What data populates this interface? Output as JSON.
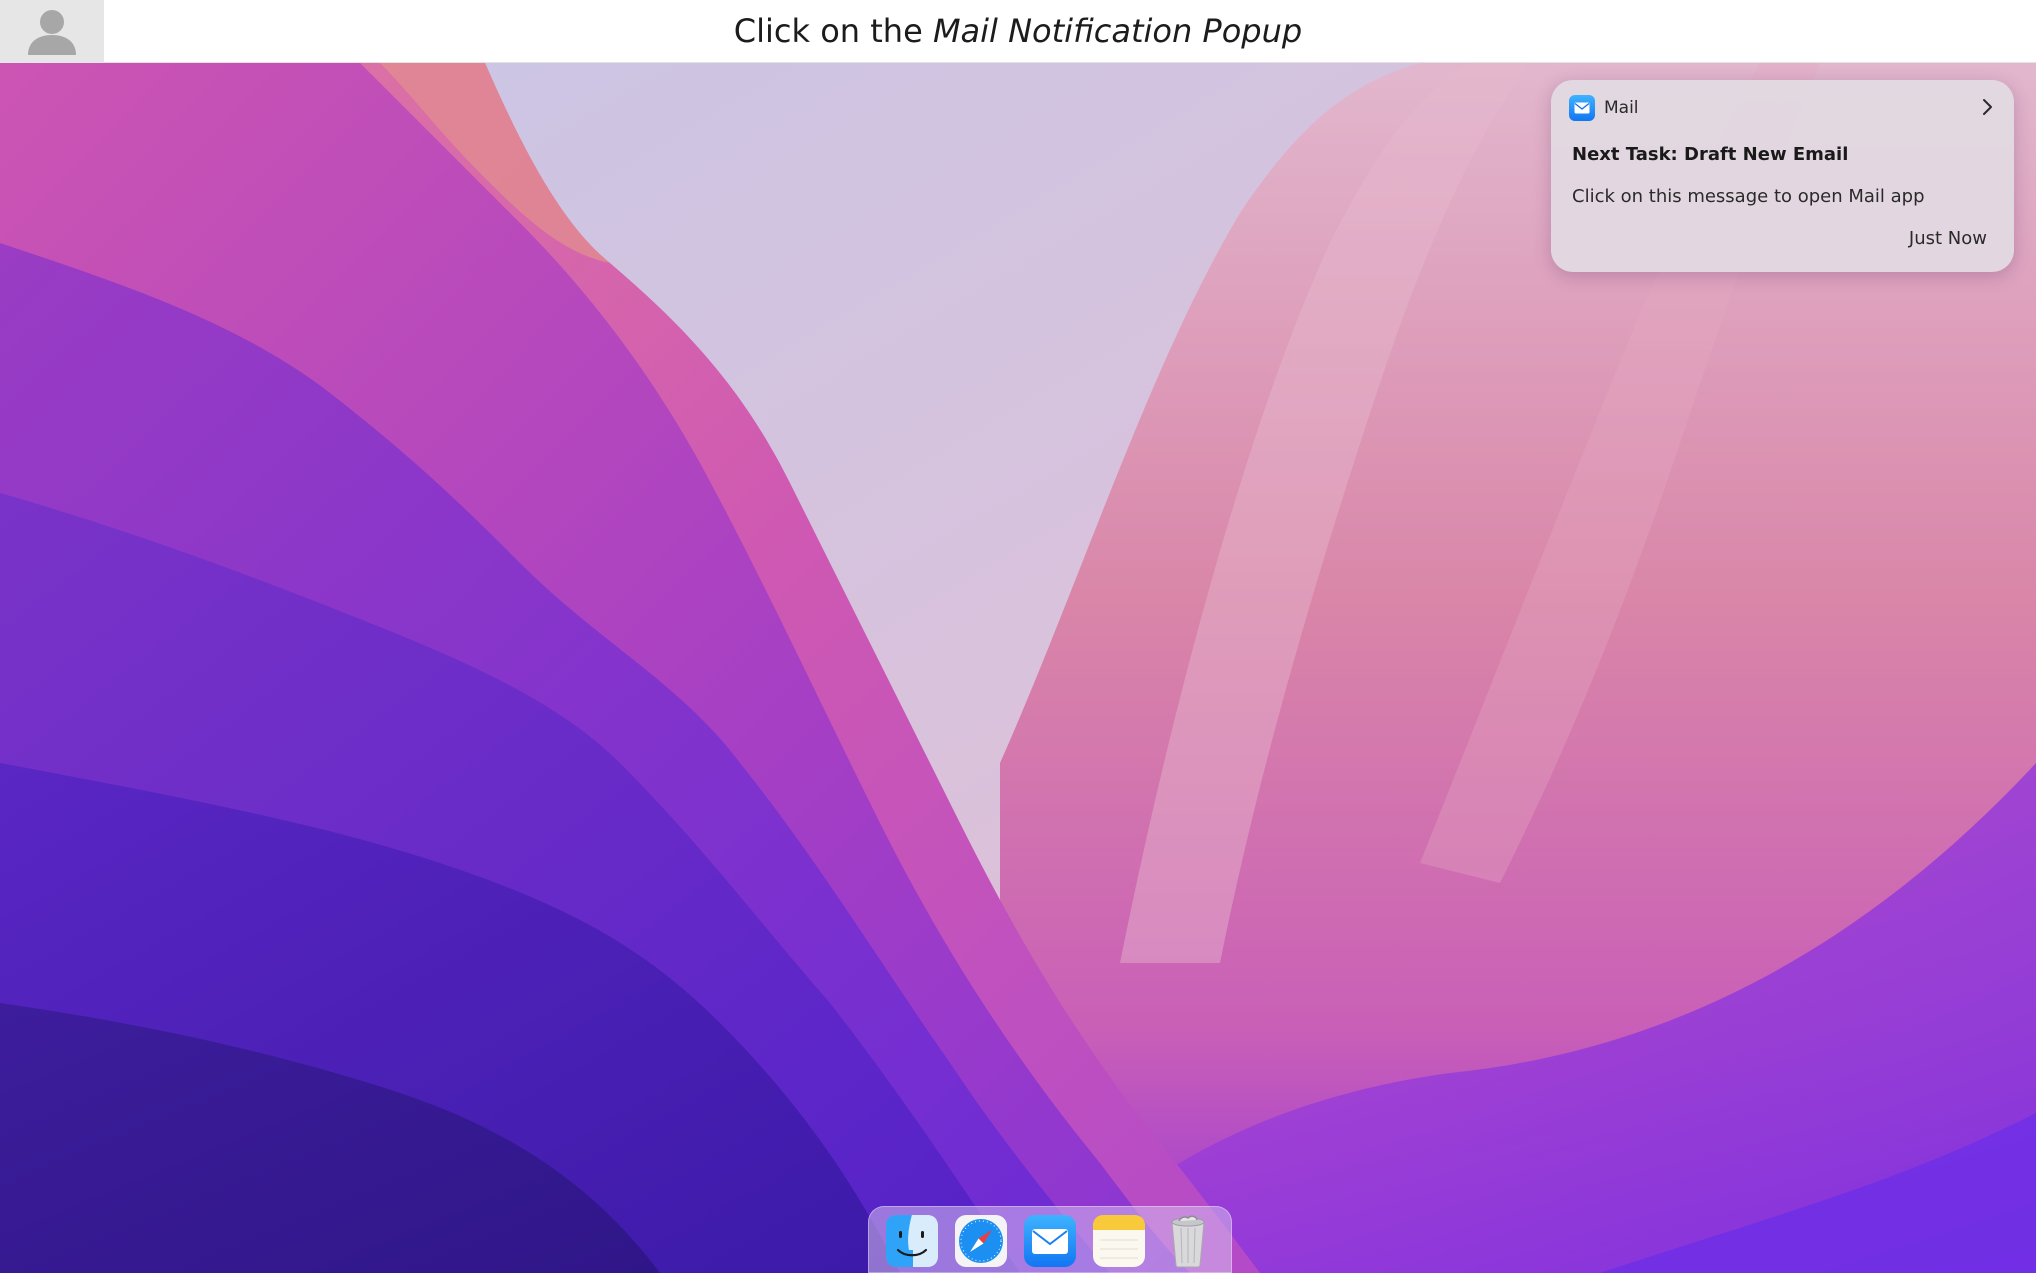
{
  "instruction": {
    "prefix": "Click on the ",
    "target": "Mail Notification Popup"
  },
  "notification": {
    "app_name": "Mail",
    "title": "Next Task: Draft New Email",
    "body": "Click on this message to open Mail app",
    "time": "Just Now"
  },
  "dock": {
    "items": [
      {
        "name": "Finder",
        "icon": "finder-icon"
      },
      {
        "name": "Safari",
        "icon": "safari-icon"
      },
      {
        "name": "Mail",
        "icon": "mail-icon"
      },
      {
        "name": "Notes",
        "icon": "notes-icon"
      },
      {
        "name": "Trash",
        "icon": "trash-icon"
      }
    ]
  },
  "colors": {
    "mail_blue": "#1276f2",
    "wallpaper_deep": "#4a1fb8",
    "wallpaper_pink": "#d86aa8"
  }
}
